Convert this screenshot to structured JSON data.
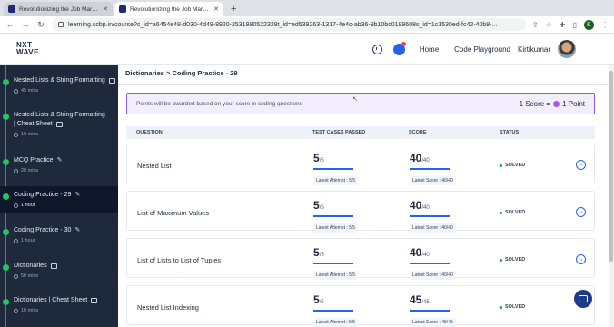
{
  "browser": {
    "tabs": [
      {
        "title": "Revolutionizing the Job Market | N"
      },
      {
        "title": "Revolutionizing the Job Market | N"
      }
    ],
    "new_tab": "+",
    "url": "learning.ccbp.in/course?c_id=a6454e48-d030-4d49-8920-2531980522328t_id=ed539263-1317-4e4c-ab36-9b10bc0199608s_id=1c1530ed-fc42-40b8-...",
    "profile_initial": "K"
  },
  "header": {
    "logo_line1": "NXT",
    "logo_line2": "WAVE",
    "home": "Home",
    "code_playground": "Code Playground",
    "user_name": "Kirtikumar"
  },
  "sidebar": {
    "items": [
      {
        "title": "Nested Lists & String Formatting",
        "meta": "45 mins",
        "icon": "book-icon"
      },
      {
        "title": "Nested Lists & String Formatting",
        "title2": "| Cheat Sheet",
        "meta": "10 mins",
        "icon": "book-icon"
      },
      {
        "title": "MCQ Practice",
        "meta": "20 mins",
        "icon": "pencil-icon"
      },
      {
        "title": "Coding Practice - 29",
        "meta": "1 hour",
        "icon": "pencil-icon"
      },
      {
        "title": "Coding Practice - 30",
        "meta": "1 hour",
        "icon": "pencil-icon"
      },
      {
        "title": "Dictionaries",
        "meta": "50 mins",
        "icon": "book-icon"
      },
      {
        "title": "Dictionaries | Cheat Sheet",
        "meta": "10 mins",
        "icon": "book-icon"
      }
    ]
  },
  "main": {
    "breadcrumb": "Dictionaries > Coding Practice - 29",
    "banner_text": "Points will be awarded based on your score in coding questions",
    "score_prefix": "1 Score =",
    "score_suffix": "1 Point",
    "columns": [
      "QUESTION",
      "TEST CASES PASSED",
      "SCORE",
      "STATUS"
    ],
    "rows": [
      {
        "question": "Nested List",
        "passed": "5",
        "passed_total": "/5",
        "attempt": "Latest Attempt : 5/5",
        "score": "40",
        "score_total": "/40",
        "latest_score": "Latest Score : 40/40",
        "status": "SOLVED"
      },
      {
        "question": "List of Maximum Values",
        "passed": "5",
        "passed_total": "/5",
        "attempt": "Latest Attempt : 5/5",
        "score": "40",
        "score_total": "/40",
        "latest_score": "Latest Score : 40/40",
        "status": "SOLVED"
      },
      {
        "question": "List of Lists to List of Tuples",
        "passed": "5",
        "passed_total": "/5",
        "attempt": "Latest Attempt : 5/5",
        "score": "40",
        "score_total": "/40",
        "latest_score": "Latest Score : 40/40",
        "status": "SOLVED"
      },
      {
        "question": "Nested List Indexing",
        "passed": "5",
        "passed_total": "/5",
        "attempt": "Latest Attempt : 5/5",
        "score": "45",
        "score_total": "/45",
        "latest_score": "Latest Score : 45/45",
        "status": "SOLVED"
      }
    ]
  },
  "colors": {
    "sidebar": "#1e293b",
    "accent": "#2563eb",
    "banner_border": "#8b5cf6",
    "solved": "#16a34a"
  }
}
